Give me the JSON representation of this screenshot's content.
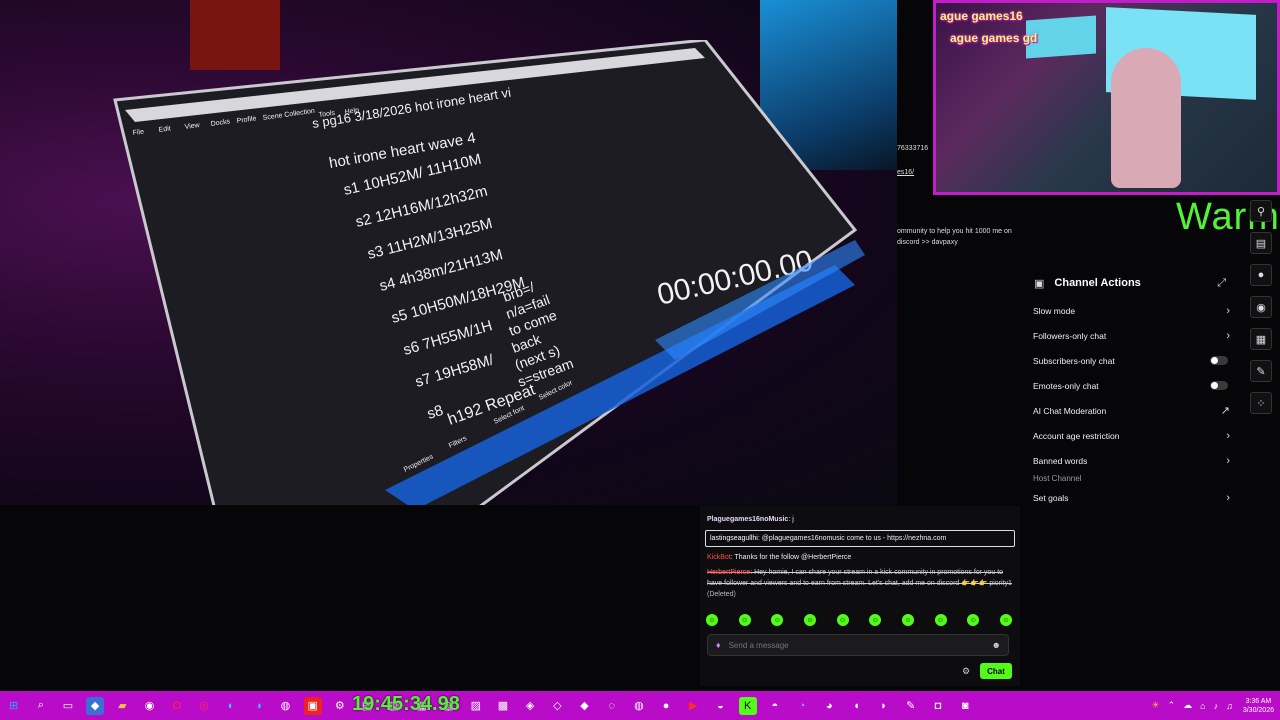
{
  "stream_overlay": {
    "pip_tag_1": "ague games16",
    "pip_tag_2": "ague games gd",
    "warm_text": "Warm",
    "clock_overlay": "19:45:34.98"
  },
  "monitor_notes": {
    "title": "s pg16 3/18/2026 hot irone heart vi",
    "subtitle": "hot irone heart wave 4",
    "lines": [
      "s1 10H52M/ 11H10M",
      "s2 12H16M/12h32m",
      "s3 11H2M/13H25M",
      "s4 4h38m/21H13M",
      "s5 10H50M/18H29M",
      "s6 7H55M/1H",
      "s7 19H58M/",
      "s8"
    ],
    "repeat": "h192 Repeat",
    "legend": [
      "brb=/",
      "n/a=fail",
      "to come",
      "back",
      "(next s)",
      "s=stream"
    ],
    "timer": "00:00:00.00",
    "menu": [
      "File",
      "Edit",
      "View",
      "Docks",
      "Profile",
      "Scene Collection",
      "Tools",
      "Help"
    ],
    "buttons": [
      "Properties",
      "Filters",
      "Select font",
      "Select color"
    ]
  },
  "stream_page": {
    "id_text": "76333716",
    "link_text": "es16/",
    "about_text": "ommunity to help you hit 1000 me on discord >> davpaxy"
  },
  "channel_actions": {
    "title": "Channel Actions",
    "items": [
      {
        "label": "Slow mode",
        "control": "arrow"
      },
      {
        "label": "Followers-only chat",
        "control": "arrow"
      },
      {
        "label": "Subscribers-only chat",
        "control": "toggle"
      },
      {
        "label": "Emotes-only chat",
        "control": "toggle"
      },
      {
        "label": "AI Chat Moderation",
        "control": "external"
      },
      {
        "label": "Account age restriction",
        "control": "arrow"
      },
      {
        "label": "Banned words",
        "control": "arrow"
      }
    ],
    "section_label": "Host Channel",
    "set_goals": "Set goals"
  },
  "chat": {
    "messages": [
      {
        "user": "Plaguegames16noMusic",
        "text": ": j"
      },
      {
        "user": "lastingseagullhi",
        "text": ": @plaguegames16nomusic come to us - https://nezhna.com"
      },
      {
        "user": "KickBot",
        "text": ": Thanks for the follow @HerbertPierce"
      },
      {
        "user": "HerbertPierce",
        "text": ": Hey homie, I can share your stream in a kick community in promotions for you to have follower and viewers and to earn from stream. Let's chat, add me on discord 👉👉👉 piority1",
        "deleted_tag": "(Deleted)"
      }
    ],
    "input_placeholder": "Send a message",
    "send_label": "Chat"
  },
  "taskbar": {
    "tray_time": "3:36 AM",
    "tray_date": "3/30/2026"
  },
  "colors": {
    "accent_green": "#53fc18",
    "taskbar": "#b90cc8",
    "pip_border": "#c21dc9"
  }
}
